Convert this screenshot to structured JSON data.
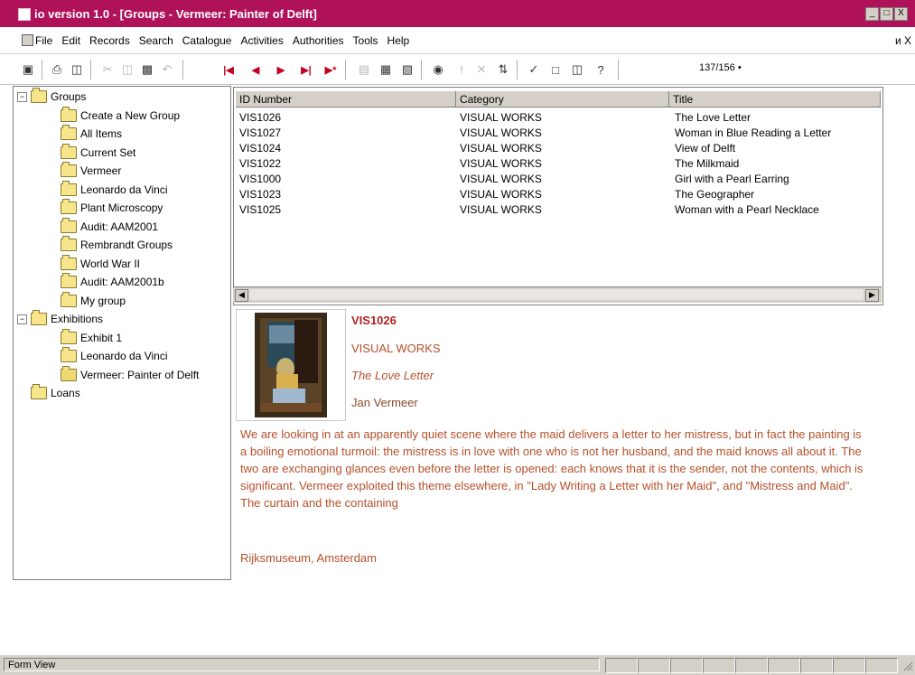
{
  "window": {
    "title": "io version 1.0 - [Groups - Vermeer: Painter of Delft]",
    "controls": [
      "_",
      "□",
      "X"
    ],
    "accent": "#b0125a"
  },
  "menubar": {
    "items": [
      "File",
      "Edit",
      "Records",
      "Search",
      "Catalogue",
      "Activities",
      "Authorities",
      "Tools",
      "Help"
    ],
    "doc_controls": "и X"
  },
  "toolbar": {
    "icons": [
      "save-icon",
      "print-icon",
      "print-preview-icon",
      "cut-icon",
      "copy-icon",
      "paste-icon",
      "undo-icon",
      "first-record-icon",
      "previous-record-icon",
      "next-record-icon",
      "last-record-icon",
      "new-record-icon",
      "form-view-icon",
      "datasheet-view-icon",
      "table-view-icon",
      "find-icon",
      "exclamation-icon",
      "delete-icon",
      "sort-icon",
      "spell-check-icon",
      "window-icon",
      "relationships-icon",
      "help-icon"
    ],
    "record_indicator": "137/156 •"
  },
  "tree": {
    "nodes": [
      {
        "label": "Groups",
        "level": 0,
        "expander": "−"
      },
      {
        "label": "Create a New Group",
        "level": 1
      },
      {
        "label": "All Items",
        "level": 1
      },
      {
        "label": "Current Set",
        "level": 1
      },
      {
        "label": "Vermeer",
        "level": 1
      },
      {
        "label": "Leonardo da Vinci",
        "level": 1
      },
      {
        "label": "Plant Microscopy",
        "level": 1
      },
      {
        "label": "Audit: AAM2001",
        "level": 1
      },
      {
        "label": "Rembrandt Groups",
        "level": 1
      },
      {
        "label": "World War II",
        "level": 1
      },
      {
        "label": "Audit: AAM2001b",
        "level": 1
      },
      {
        "label": "My group",
        "level": 1
      },
      {
        "label": "Exhibitions",
        "level": 0,
        "expander": "−"
      },
      {
        "label": "Exhibit 1",
        "level": 1
      },
      {
        "label": "Leonardo da Vinci",
        "level": 1
      },
      {
        "label": "Vermeer: Painter of Delft",
        "level": 1,
        "open": true
      },
      {
        "label": "Loans",
        "level": 0
      }
    ]
  },
  "grid": {
    "columns": [
      "ID Number",
      "Category",
      "Title"
    ],
    "rows": [
      [
        "VIS1026",
        "VISUAL WORKS",
        "The Love Letter"
      ],
      [
        "VIS1027",
        "VISUAL WORKS",
        "Woman in Blue Reading a Letter"
      ],
      [
        "VIS1024",
        "VISUAL WORKS",
        "View of Delft"
      ],
      [
        "VIS1022",
        "VISUAL WORKS",
        "The Milkmaid"
      ],
      [
        "VIS1000",
        "VISUAL WORKS",
        "Girl with a Pearl Earring"
      ],
      [
        "VIS1023",
        "VISUAL WORKS",
        "The Geographer"
      ],
      [
        "VIS1025",
        "VISUAL WORKS",
        "Woman with a Pearl Necklace"
      ]
    ]
  },
  "detail": {
    "id": "VIS1026",
    "category": "VISUAL WORKS",
    "title": "The Love Letter",
    "artist": "Jan Vermeer",
    "description": "We are looking in at an apparently quiet scene where the maid delivers a letter to her mistress, but in fact the painting is a boiling emotional turmoil: the mistress is in love with one who is not her husband, and the maid knows all about it. The two are exchanging glances even before the letter is opened: each knows that it is the sender, not the contents, which is significant. Vermeer exploited this theme elsewhere, in \"Lady Writing a Letter with her Maid\", and \"Mistress and Maid\". The curtain and the containing",
    "location": "Rijksmuseum, Amsterdam",
    "colors": {
      "id": "#b22222",
      "text": "#b5502a"
    }
  },
  "statusbar": {
    "mode": "Form View"
  }
}
